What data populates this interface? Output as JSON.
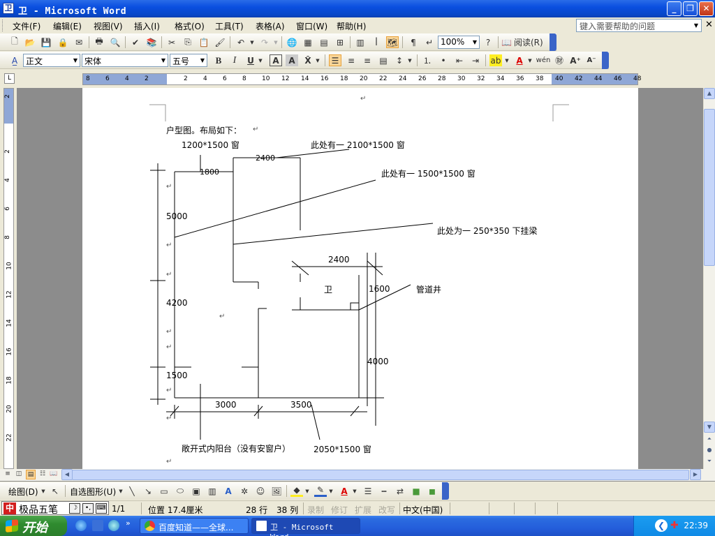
{
  "window": {
    "title": "卫 - Microsoft Word",
    "app_icon": "卫"
  },
  "menu": {
    "items": [
      "文件(F)",
      "编辑(E)",
      "视图(V)",
      "插入(I)",
      "格式(O)",
      "工具(T)",
      "表格(A)",
      "窗口(W)",
      "帮助(H)"
    ],
    "help_placeholder": "键入需要帮助的问题"
  },
  "toolbar": {
    "zoom": "100%",
    "read_label": "阅读(R)",
    "style": "正文",
    "font": "宋体",
    "size": "五号"
  },
  "ruler": {
    "h_numbers": [
      "8",
      "6",
      "4",
      "2",
      "2",
      "4",
      "6",
      "8",
      "10",
      "12",
      "14",
      "16",
      "18",
      "20",
      "22",
      "24",
      "26",
      "28",
      "30",
      "32",
      "34",
      "36",
      "38",
      "40",
      "42",
      "44",
      "46",
      "48"
    ],
    "v_numbers": [
      "2",
      "2",
      "4",
      "6",
      "8",
      "10",
      "12",
      "14",
      "16",
      "18",
      "20",
      "22"
    ]
  },
  "document": {
    "intro": "户型图。布局如下：",
    "note_window_1200": "1200*1500 窗",
    "note_window_2100": "此处有一 2100*1500 窗",
    "note_window_1500": "此处有一 1500*1500 窗",
    "note_beam": "此处为一 250*350 下挂梁",
    "note_shaft": "管道井",
    "note_balcony": "敞开式内阳台（没有安窗户）",
    "note_window_2050": "2050*1500 窗",
    "dim_1800": "1800",
    "dim_2400_top": "2400",
    "dim_5000": "5000",
    "dim_2400_bath": "2400",
    "dim_1600": "1600",
    "label_bath": "卫",
    "dim_4200": "4200",
    "dim_4000": "4000",
    "dim_1500": "1500",
    "dim_3000": "3000",
    "dim_3500": "3500"
  },
  "drawing_toolbar": {
    "draw": "绘图(D)",
    "autoshape": "自选图形(U)"
  },
  "status": {
    "ime_name": "极品五笔",
    "page": "1/1",
    "position": "位置 17.4厘米",
    "line": "28 行",
    "col": "38 列",
    "rec": "录制",
    "trk": "修订",
    "ext": "扩展",
    "ovr": "改写",
    "lang": "中文(中国)"
  },
  "taskbar": {
    "start": "开始",
    "task1": "百度知道——全球...",
    "task2": "卫 - Microsoft Word",
    "clock": "22:39"
  }
}
